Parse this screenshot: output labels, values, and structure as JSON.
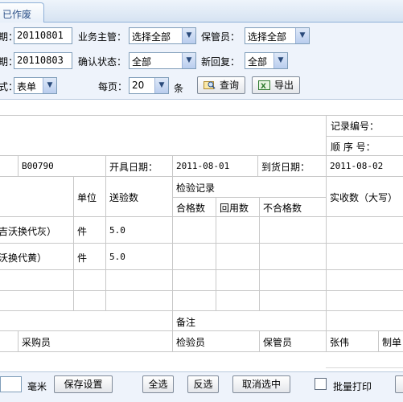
{
  "tab": {
    "label": "已作废"
  },
  "filters": {
    "date_from_label": "期：",
    "date_from_value": "20110801",
    "date_to_label": "期：",
    "date_to_value": "20110803",
    "supervisor_label": "业务主管：",
    "supervisor_value": "选择全部",
    "keeper_label": "保管员：",
    "keeper_value": "选择全部",
    "confirm_label": "确认状态：",
    "confirm_value": "全部",
    "reply_label": "新回复：",
    "reply_value": "全部",
    "type_label": "式：",
    "type_value": "表单",
    "perpage_label": "每页：",
    "perpage_value": "20",
    "perpage_unit": "条",
    "query_button": "查询",
    "export_button": "导出"
  },
  "doc": {
    "record_no_label": "记录编号：",
    "seq_no_label": "顺 序 号：",
    "code": "B00790",
    "issue_date_label": "开具日期：",
    "issue_date": "2011-08-01",
    "arrival_date_label": "到货日期：",
    "arrival_date": "2011-08-02",
    "col_unit": "单位",
    "col_sent_qty": "送验数",
    "col_inspection": "检验记录",
    "col_qualified": "合格数",
    "col_returned": "回用数",
    "col_unqualified": "不合格数",
    "col_actual": "实收数（大写）",
    "rows": [
      {
        "name": "吉沃换代灰）",
        "unit": "件",
        "qty": "5.0"
      },
      {
        "name": "沃换代黄）",
        "unit": "件",
        "qty": "5.0"
      }
    ],
    "remark_label": "备注",
    "buyer_label": "采购员",
    "inspector_label": "检验员",
    "keeper_label": "保管员",
    "keeper_name": "张伟",
    "maker_label": "制单"
  },
  "bottom": {
    "unit_label": "毫米",
    "save_settings": "保存设置",
    "select_all": "全选",
    "invert": "反选",
    "cancel_select": "取消选中",
    "batch_print": "批量打印"
  },
  "colors": {
    "panel": "#eef3fb",
    "border": "#7f9db9",
    "grid": "#c8c8c8"
  }
}
